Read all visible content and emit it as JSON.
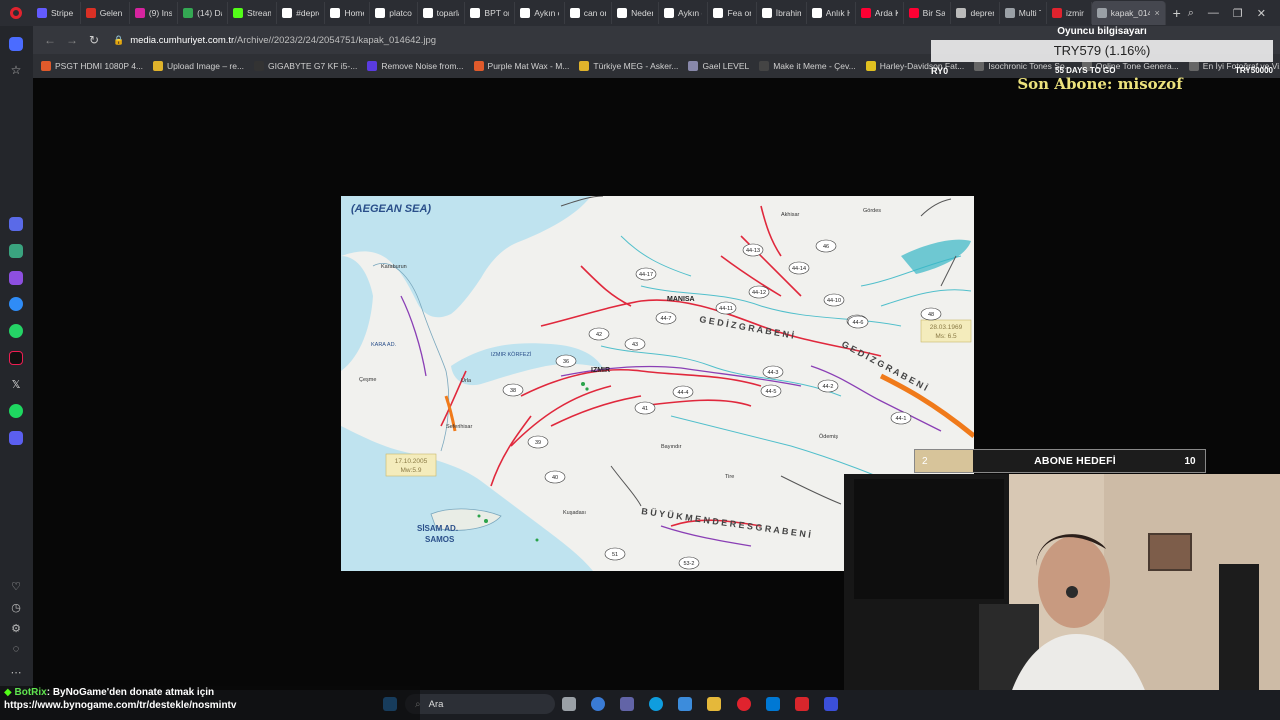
{
  "browser": {
    "tabs": [
      {
        "label": "Stripe I",
        "color": "#635bff"
      },
      {
        "label": "Gelen I",
        "color": "#d93025"
      },
      {
        "label": "(9) Inst",
        "color": "#d6249f"
      },
      {
        "label": "(14) Da",
        "color": "#34a853"
      },
      {
        "label": "Stream",
        "color": "#53fc18"
      },
      {
        "label": "#depre",
        "color": "#ffffff"
      },
      {
        "label": "Home",
        "color": "#ffffff"
      },
      {
        "label": "platcor",
        "color": "#ffffff"
      },
      {
        "label": "toparla",
        "color": "#ffffff"
      },
      {
        "label": "BPT on",
        "color": "#ffffff"
      },
      {
        "label": "Aykın c",
        "color": "#ffffff"
      },
      {
        "label": "can on",
        "color": "#ffffff"
      },
      {
        "label": "Neden",
        "color": "#ffffff"
      },
      {
        "label": "Aykın c",
        "color": "#ffffff"
      },
      {
        "label": "Fea on",
        "color": "#ffffff"
      },
      {
        "label": "İbrahim",
        "color": "#ffffff"
      },
      {
        "label": "Anlık H",
        "color": "#ffffff"
      },
      {
        "label": "Arda K",
        "color": "#ff0033"
      },
      {
        "label": "Bir Sar",
        "color": "#ff0033"
      },
      {
        "label": "depren",
        "color": "#bbbbbb"
      },
      {
        "label": "Multi T",
        "color": "#9aa0a6"
      },
      {
        "label": "izmir f",
        "color": "#e0232e"
      },
      {
        "label": "kapak_0146",
        "color": "#9aa0a6",
        "active": true
      }
    ],
    "new_tab_label": "+",
    "window_controls": [
      "⌕",
      "—",
      "❐",
      "✕"
    ],
    "url_domain": "media.cumhuriyet.com.tr",
    "url_path": "/Archive//2023/2/24/2054751/kapak_014642.jpg",
    "bookmarks": [
      {
        "label": "PSGT HDMI 1080P 4...",
        "color": "#e05a2b"
      },
      {
        "label": "Upload Image – re...",
        "color": "#e0b32b"
      },
      {
        "label": "GIGABYTE G7 KF i5-...",
        "color": "#333333"
      },
      {
        "label": "Remove Noise from...",
        "color": "#5a3be0"
      },
      {
        "label": "Purple Mat Wax - M...",
        "color": "#e05a2b"
      },
      {
        "label": "Türkiye MEG - Asker...",
        "color": "#e0b32b"
      },
      {
        "label": "Gael LEVEL",
        "color": "#8888aa"
      },
      {
        "label": "Make it Meme - Çev...",
        "color": "#444444"
      },
      {
        "label": "Harley-Davidson Fat...",
        "color": "#e0c020"
      },
      {
        "label": "Isochronic Tones So...",
        "color": "#666666"
      },
      {
        "label": "Online Tone Genera...",
        "color": "#666666"
      },
      {
        "label": "En İyi Fotoğraf ve Vi...",
        "color": "#666666"
      }
    ]
  },
  "map": {
    "sea_label": "(AEGEAN SEA)",
    "city_labels": {
      "manisa": "MANISA",
      "izmir": "IZMIR",
      "izmir_korfezi": "IZMIR KÖRFEZİ",
      "karaada": "KARA AD.",
      "karaburun": "Karaburun",
      "cesme": "Çeşme",
      "urla": "Urla",
      "seferihisar": "Seferihisar",
      "tire": "Tire",
      "bayindir": "Bayındır",
      "odemis": "Ödemiş",
      "kusadasi": "Kuşadası",
      "sisam": "SİSAM AD.",
      "samos": "SAMOS",
      "gordes": "Gördes",
      "akhisar": "Akhisar"
    },
    "graben_labels": {
      "gediz1": "G E D İ Z   G R A B E N İ",
      "gediz2": "G E D İ Z   G R A B E N İ",
      "buyuk_menderes": "B Ü Y Ü K   M E N D E R E S   G R A B E N İ"
    },
    "eq1_date": "17.10.2005",
    "eq1_mag": "Mw:5.9",
    "eq2_date": "28.03.1969",
    "eq2_mag": "Ms: 6.5",
    "fault_ids": [
      "44-17",
      "44-11",
      "44-12",
      "44-13",
      "44-14",
      "44-10",
      "44-9",
      "44-7",
      "44-4",
      "44-6",
      "44-3",
      "44-2",
      "44-1",
      "44-5",
      "43",
      "42",
      "41",
      "40",
      "39",
      "38",
      "36",
      "46",
      "48",
      "53-2",
      "51"
    ]
  },
  "overlay": {
    "oyuncu_title": "Oyuncu bilgisayarı",
    "oyuncu_value": "TRY579 (1.16%)",
    "oyuncu_left": "RY0",
    "oyuncu_mid": "55 DAYS TO GO",
    "oyuncu_right": "TRY50000",
    "son_abone": "Son Abone: misozof",
    "abone_hedefi_label": "ABONE HEDEFİ",
    "abone_current": "2",
    "abone_goal": "10",
    "abone_fraction": 0.2
  },
  "chat": {
    "username": "BotRix",
    "message": ": ByNoGame'den donate atmak için",
    "link": "https://www.bynogame.com/tr/destekle/nosmintv"
  },
  "taskbar": {
    "search_placeholder": "Ara"
  },
  "colors": {
    "fault_red": "#e0283c",
    "fault_purple": "#8a3fb5",
    "river_cyan": "#36b7c6",
    "sea": "#bfe3ef",
    "accent_yellow": "#ece27c"
  }
}
